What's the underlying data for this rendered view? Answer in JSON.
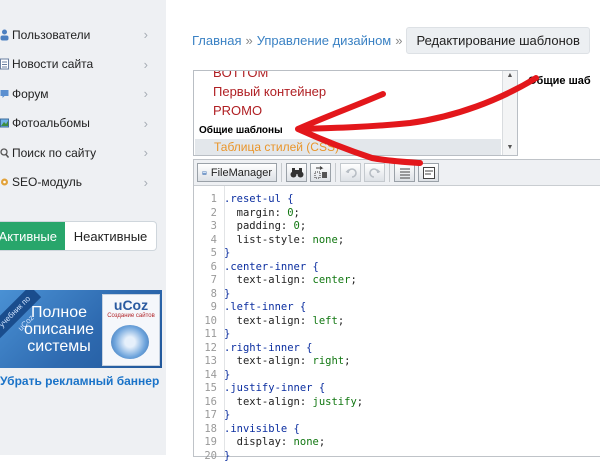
{
  "sidebar": {
    "items": [
      {
        "label": "Пользователи",
        "icon": "users-icon",
        "chevron": "›"
      },
      {
        "label": "Новости сайта",
        "icon": "news-icon",
        "chevron": "›"
      },
      {
        "label": "Форум",
        "icon": "forum-icon",
        "chevron": "›"
      },
      {
        "label": "Фотоальбомы",
        "icon": "photo-albums-icon",
        "chevron": "›"
      },
      {
        "label": "Поиск по сайту",
        "icon": "search-icon",
        "chevron": "›"
      },
      {
        "label": "SEO-модуль",
        "icon": "seo-icon",
        "chevron": "›"
      }
    ],
    "tabs": {
      "active": "Активные",
      "inactive": "Неактивные"
    },
    "banner": {
      "ribbon": "учебник по uCoz",
      "text_line1": "Полное",
      "text_line2": "описание",
      "text_line3": "системы",
      "box_title": "uCoz",
      "box_sub": "Создание сайтов",
      "link": "Убрать рекламный баннер"
    }
  },
  "breadcrumb": {
    "home": "Главная",
    "separator": "»",
    "section": "Управление дизайном",
    "current": "Редактирование шаблонов"
  },
  "template_list": {
    "items": [
      "BOTTOM",
      "Первый контейнер",
      "PROMO"
    ],
    "group": "Общие шаблоны",
    "selected": "Таблица стилей (CSS)"
  },
  "group_title": "Общие шаб",
  "toolbar": {
    "filemanager": "FileManager"
  },
  "code_lines": [
    {
      "n": "1",
      "parts": [
        {
          "t": ".reset-ul {",
          "c": "sel"
        }
      ]
    },
    {
      "n": "2",
      "parts": [
        {
          "t": "  margin: ",
          "c": "prop"
        },
        {
          "t": "0",
          "c": "val"
        },
        {
          "t": ";",
          "c": "prop"
        }
      ]
    },
    {
      "n": "3",
      "parts": [
        {
          "t": "  padding: ",
          "c": "prop"
        },
        {
          "t": "0",
          "c": "val"
        },
        {
          "t": ";",
          "c": "prop"
        }
      ]
    },
    {
      "n": "4",
      "parts": [
        {
          "t": "  list-style: ",
          "c": "prop"
        },
        {
          "t": "none",
          "c": "val"
        },
        {
          "t": ";",
          "c": "prop"
        }
      ]
    },
    {
      "n": "5",
      "parts": [
        {
          "t": "}",
          "c": "sel"
        }
      ]
    },
    {
      "n": "6",
      "parts": [
        {
          "t": ".center-inner {",
          "c": "sel"
        }
      ]
    },
    {
      "n": "7",
      "parts": [
        {
          "t": "  text-align: ",
          "c": "prop"
        },
        {
          "t": "center",
          "c": "val"
        },
        {
          "t": ";",
          "c": "prop"
        }
      ]
    },
    {
      "n": "8",
      "parts": [
        {
          "t": "}",
          "c": "sel"
        }
      ]
    },
    {
      "n": "9",
      "parts": [
        {
          "t": ".left-inner {",
          "c": "sel"
        }
      ]
    },
    {
      "n": "10",
      "parts": [
        {
          "t": "  text-align: ",
          "c": "prop"
        },
        {
          "t": "left",
          "c": "val"
        },
        {
          "t": ";",
          "c": "prop"
        }
      ]
    },
    {
      "n": "11",
      "parts": [
        {
          "t": "}",
          "c": "sel"
        }
      ]
    },
    {
      "n": "12",
      "parts": [
        {
          "t": ".right-inner {",
          "c": "sel"
        }
      ]
    },
    {
      "n": "13",
      "parts": [
        {
          "t": "  text-align: ",
          "c": "prop"
        },
        {
          "t": "right",
          "c": "val"
        },
        {
          "t": ";",
          "c": "prop"
        }
      ]
    },
    {
      "n": "14",
      "parts": [
        {
          "t": "}",
          "c": "sel"
        }
      ]
    },
    {
      "n": "15",
      "parts": [
        {
          "t": ".justify-inner {",
          "c": "sel"
        }
      ]
    },
    {
      "n": "16",
      "parts": [
        {
          "t": "  text-align: ",
          "c": "prop"
        },
        {
          "t": "justify",
          "c": "val"
        },
        {
          "t": ";",
          "c": "prop"
        }
      ]
    },
    {
      "n": "17",
      "parts": [
        {
          "t": "}",
          "c": "sel"
        }
      ]
    },
    {
      "n": "18",
      "parts": [
        {
          "t": ".invisible {",
          "c": "sel"
        }
      ]
    },
    {
      "n": "19",
      "parts": [
        {
          "t": "  display: ",
          "c": "prop"
        },
        {
          "t": "none",
          "c": "val"
        },
        {
          "t": ";",
          "c": "prop"
        }
      ]
    },
    {
      "n": "20",
      "parts": [
        {
          "t": "}",
          "c": "sel"
        }
      ]
    }
  ],
  "colors": {
    "link": "#3b82c4",
    "active_tab": "#28a66b",
    "template_item": "#b02024",
    "selected_template": "#e9952a",
    "annotation_arrow": "#e3171b"
  }
}
